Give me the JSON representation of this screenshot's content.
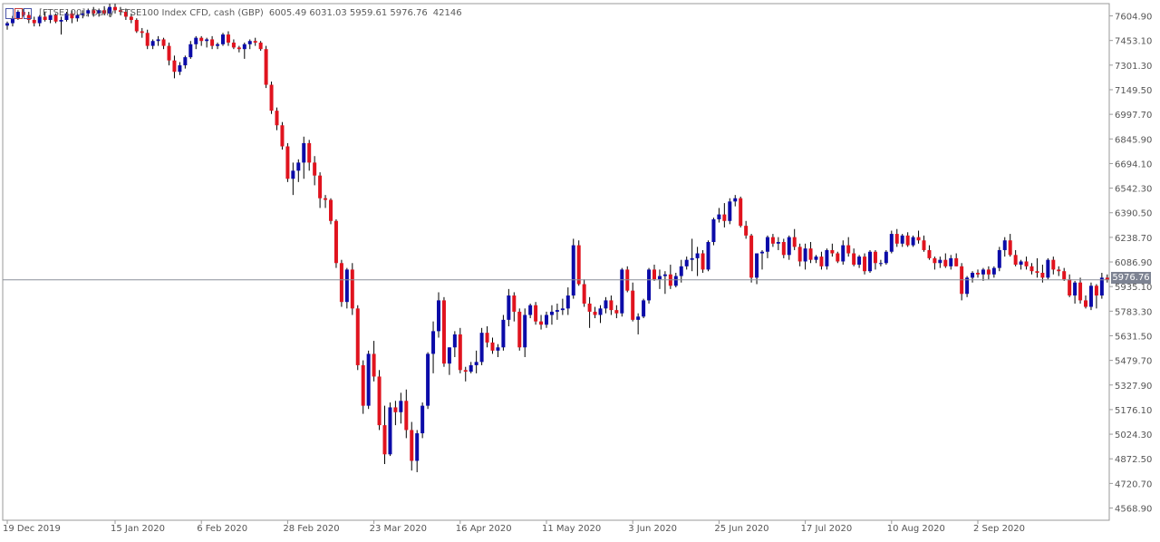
{
  "header": {
    "symbol": "[FTSE100], Daily",
    "description": "FTSE100 Index CFD, cash (GBP)",
    "ohlc": "6005.49 6031.03 5959.61 5976.76",
    "volume": "42146"
  },
  "colors": {
    "up": "#0b0ba8",
    "down": "#e0131e",
    "wick": "#000000",
    "current_line": "#8a8f9a",
    "tag_bg": "#7d8392"
  },
  "chart_data": {
    "type": "candlestick",
    "title": "",
    "xlabel": "",
    "ylabel": "",
    "current_price": "5976.76",
    "ylim": [
      4493.5,
      7680.6
    ],
    "y_ticks": [
      "7604.90",
      "7453.10",
      "7301.30",
      "7149.50",
      "6997.70",
      "6845.90",
      "6694.10",
      "6542.30",
      "6390.50",
      "6238.70",
      "6086.90",
      "5935.10",
      "5783.30",
      "5631.50",
      "5479.70",
      "5327.90",
      "5176.10",
      "5024.30",
      "4872.50",
      "4720.70",
      "4568.90"
    ],
    "x_ticks": [
      {
        "label": "19 Dec 2019",
        "index": 0
      },
      {
        "label": "15 Jan 2020",
        "index": 20
      },
      {
        "label": "6 Feb 2020",
        "index": 36
      },
      {
        "label": "28 Feb 2020",
        "index": 52
      },
      {
        "label": "23 Mar 2020",
        "index": 68
      },
      {
        "label": "16 Apr 2020",
        "index": 84
      },
      {
        "label": "11 May 2020",
        "index": 100
      },
      {
        "label": "3 Jun 2020",
        "index": 116
      },
      {
        "label": "25 Jun 2020",
        "index": 132
      },
      {
        "label": "17 Jul 2020",
        "index": 148
      },
      {
        "label": "10 Aug 2020",
        "index": 164
      },
      {
        "label": "2 Sep 2020",
        "index": 180
      }
    ],
    "candles": [
      [
        7545,
        7570,
        7520,
        7560
      ],
      [
        7560,
        7605,
        7540,
        7590
      ],
      [
        7590,
        7640,
        7580,
        7630
      ],
      [
        7630,
        7650,
        7600,
        7610
      ],
      [
        7610,
        7630,
        7560,
        7580
      ],
      [
        7580,
        7600,
        7540,
        7560
      ],
      [
        7560,
        7610,
        7540,
        7600
      ],
      [
        7600,
        7630,
        7570,
        7580
      ],
      [
        7580,
        7620,
        7560,
        7610
      ],
      [
        7610,
        7620,
        7560,
        7570
      ],
      [
        7570,
        7600,
        7490,
        7580
      ],
      [
        7580,
        7630,
        7570,
        7620
      ],
      [
        7620,
        7640,
        7560,
        7590
      ],
      [
        7590,
        7620,
        7570,
        7610
      ],
      [
        7610,
        7640,
        7590,
        7620
      ],
      [
        7620,
        7650,
        7600,
        7640
      ],
      [
        7640,
        7660,
        7600,
        7620
      ],
      [
        7620,
        7650,
        7600,
        7640
      ],
      [
        7640,
        7665,
        7610,
        7620
      ],
      [
        7620,
        7680,
        7600,
        7660
      ],
      [
        7660,
        7680,
        7620,
        7640
      ],
      [
        7640,
        7660,
        7610,
        7630
      ],
      [
        7630,
        7650,
        7580,
        7600
      ],
      [
        7600,
        7620,
        7560,
        7580
      ],
      [
        7580,
        7590,
        7500,
        7510
      ],
      [
        7510,
        7530,
        7470,
        7500
      ],
      [
        7500,
        7520,
        7400,
        7420
      ],
      [
        7420,
        7460,
        7400,
        7450
      ],
      [
        7450,
        7480,
        7420,
        7460
      ],
      [
        7460,
        7470,
        7400,
        7420
      ],
      [
        7420,
        7440,
        7300,
        7330
      ],
      [
        7330,
        7360,
        7220,
        7260
      ],
      [
        7260,
        7320,
        7240,
        7300
      ],
      [
        7300,
        7360,
        7280,
        7350
      ],
      [
        7350,
        7450,
        7340,
        7430
      ],
      [
        7430,
        7480,
        7400,
        7470
      ],
      [
        7470,
        7480,
        7420,
        7450
      ],
      [
        7450,
        7470,
        7410,
        7460
      ],
      [
        7460,
        7480,
        7400,
        7420
      ],
      [
        7420,
        7440,
        7400,
        7430
      ],
      [
        7430,
        7500,
        7420,
        7490
      ],
      [
        7490,
        7510,
        7420,
        7440
      ],
      [
        7440,
        7460,
        7400,
        7410
      ],
      [
        7410,
        7420,
        7380,
        7400
      ],
      [
        7400,
        7440,
        7340,
        7430
      ],
      [
        7430,
        7460,
        7400,
        7450
      ],
      [
        7450,
        7470,
        7420,
        7440
      ],
      [
        7440,
        7450,
        7390,
        7400
      ],
      [
        7400,
        7420,
        7160,
        7180
      ],
      [
        7180,
        7200,
        7000,
        7020
      ],
      [
        7020,
        7040,
        6900,
        6930
      ],
      [
        6930,
        6950,
        6780,
        6800
      ],
      [
        6800,
        6820,
        6580,
        6600
      ],
      [
        6600,
        6700,
        6500,
        6650
      ],
      [
        6650,
        6720,
        6580,
        6700
      ],
      [
        6700,
        6860,
        6600,
        6820
      ],
      [
        6820,
        6840,
        6650,
        6700
      ],
      [
        6700,
        6740,
        6560,
        6620
      ],
      [
        6620,
        6640,
        6420,
        6480
      ],
      [
        6480,
        6500,
        6420,
        6470
      ],
      [
        6470,
        6480,
        6320,
        6340
      ],
      [
        6340,
        6350,
        6050,
        6080
      ],
      [
        6080,
        6100,
        5810,
        5840
      ],
      [
        5840,
        6050,
        5800,
        6040
      ],
      [
        6040,
        6080,
        5760,
        5800
      ],
      [
        5800,
        5820,
        5420,
        5450
      ],
      [
        5450,
        5480,
        5150,
        5200
      ],
      [
        5200,
        5540,
        5180,
        5520
      ],
      [
        5520,
        5600,
        5350,
        5380
      ],
      [
        5380,
        5420,
        5050,
        5080
      ],
      [
        5080,
        5200,
        4840,
        4900
      ],
      [
        4900,
        5220,
        4890,
        5190
      ],
      [
        5190,
        5230,
        5080,
        5160
      ],
      [
        5160,
        5280,
        5090,
        5230
      ],
      [
        5230,
        5300,
        5000,
        5050
      ],
      [
        5050,
        5100,
        4800,
        4860
      ],
      [
        4860,
        5050,
        4790,
        5030
      ],
      [
        5030,
        5220,
        5000,
        5200
      ],
      [
        5200,
        5530,
        5180,
        5520
      ],
      [
        5520,
        5720,
        5400,
        5660
      ],
      [
        5660,
        5900,
        5620,
        5850
      ],
      [
        5850,
        5870,
        5440,
        5460
      ],
      [
        5460,
        5560,
        5390,
        5560
      ],
      [
        5560,
        5660,
        5500,
        5640
      ],
      [
        5640,
        5680,
        5400,
        5420
      ],
      [
        5420,
        5440,
        5350,
        5410
      ],
      [
        5410,
        5470,
        5400,
        5450
      ],
      [
        5450,
        5540,
        5400,
        5470
      ],
      [
        5470,
        5680,
        5450,
        5650
      ],
      [
        5650,
        5690,
        5560,
        5590
      ],
      [
        5590,
        5620,
        5520,
        5540
      ],
      [
        5540,
        5580,
        5500,
        5560
      ],
      [
        5560,
        5760,
        5540,
        5730
      ],
      [
        5730,
        5920,
        5690,
        5880
      ],
      [
        5880,
        5900,
        5720,
        5780
      ],
      [
        5780,
        5800,
        5540,
        5560
      ],
      [
        5560,
        5800,
        5500,
        5760
      ],
      [
        5760,
        5830,
        5740,
        5820
      ],
      [
        5820,
        5840,
        5700,
        5720
      ],
      [
        5720,
        5760,
        5670,
        5700
      ],
      [
        5700,
        5780,
        5680,
        5760
      ],
      [
        5760,
        5820,
        5700,
        5780
      ],
      [
        5780,
        5830,
        5730,
        5790
      ],
      [
        5790,
        5860,
        5760,
        5800
      ],
      [
        5800,
        5930,
        5760,
        5880
      ],
      [
        5880,
        6230,
        5860,
        6190
      ],
      [
        6190,
        6220,
        5940,
        5950
      ],
      [
        5950,
        5980,
        5810,
        5830
      ],
      [
        5830,
        5870,
        5680,
        5780
      ],
      [
        5780,
        5810,
        5740,
        5760
      ],
      [
        5760,
        5820,
        5710,
        5800
      ],
      [
        5800,
        5870,
        5770,
        5850
      ],
      [
        5850,
        5880,
        5760,
        5790
      ],
      [
        5790,
        5820,
        5740,
        5770
      ],
      [
        5770,
        6050,
        5750,
        6040
      ],
      [
        6040,
        6060,
        5900,
        5910
      ],
      [
        5910,
        5960,
        5720,
        5730
      ],
      [
        5730,
        5770,
        5640,
        5750
      ],
      [
        5750,
        5860,
        5740,
        5850
      ],
      [
        5850,
        6050,
        5830,
        6040
      ],
      [
        6040,
        6070,
        5970,
        5980
      ],
      [
        5980,
        6040,
        5920,
        6000
      ],
      [
        6000,
        6030,
        5890,
        6010
      ],
      [
        6010,
        6070,
        5920,
        5940
      ],
      [
        5940,
        6020,
        5930,
        6000
      ],
      [
        6000,
        6100,
        5960,
        6060
      ],
      [
        6060,
        6120,
        6040,
        6100
      ],
      [
        6100,
        6230,
        6030,
        6110
      ],
      [
        6110,
        6180,
        6000,
        6140
      ],
      [
        6140,
        6160,
        6020,
        6040
      ],
      [
        6040,
        6220,
        6030,
        6210
      ],
      [
        6210,
        6360,
        6190,
        6350
      ],
      [
        6350,
        6420,
        6330,
        6380
      ],
      [
        6380,
        6450,
        6300,
        6340
      ],
      [
        6340,
        6480,
        6320,
        6460
      ],
      [
        6460,
        6500,
        6430,
        6480
      ],
      [
        6480,
        6490,
        6300,
        6310
      ],
      [
        6310,
        6340,
        6230,
        6250
      ],
      [
        6250,
        6260,
        5960,
        5990
      ],
      [
        5990,
        6140,
        5950,
        6140
      ],
      [
        6140,
        6160,
        6040,
        6150
      ],
      [
        6150,
        6250,
        6110,
        6240
      ],
      [
        6240,
        6260,
        6180,
        6200
      ],
      [
        6200,
        6240,
        6160,
        6210
      ],
      [
        6210,
        6230,
        6110,
        6130
      ],
      [
        6130,
        6250,
        6100,
        6240
      ],
      [
        6240,
        6290,
        6160,
        6180
      ],
      [
        6180,
        6200,
        6060,
        6090
      ],
      [
        6090,
        6200,
        6040,
        6170
      ],
      [
        6170,
        6210,
        6080,
        6100
      ],
      [
        6100,
        6130,
        6080,
        6120
      ],
      [
        6120,
        6150,
        6040,
        6060
      ],
      [
        6060,
        6170,
        6040,
        6160
      ],
      [
        6160,
        6200,
        6120,
        6140
      ],
      [
        6140,
        6150,
        6080,
        6090
      ],
      [
        6090,
        6220,
        6070,
        6190
      ],
      [
        6190,
        6240,
        6120,
        6140
      ],
      [
        6140,
        6170,
        6060,
        6070
      ],
      [
        6070,
        6130,
        6050,
        6120
      ],
      [
        6120,
        6140,
        6010,
        6030
      ],
      [
        6030,
        6160,
        6020,
        6150
      ],
      [
        6150,
        6160,
        6040,
        6080
      ],
      [
        6080,
        6100,
        6060,
        6080
      ],
      [
        6080,
        6160,
        6070,
        6150
      ],
      [
        6150,
        6280,
        6140,
        6260
      ],
      [
        6260,
        6290,
        6180,
        6200
      ],
      [
        6200,
        6260,
        6180,
        6250
      ],
      [
        6250,
        6270,
        6180,
        6190
      ],
      [
        6190,
        6250,
        6180,
        6240
      ],
      [
        6240,
        6280,
        6200,
        6220
      ],
      [
        6220,
        6250,
        6150,
        6160
      ],
      [
        6160,
        6190,
        6100,
        6110
      ],
      [
        6110,
        6120,
        6040,
        6080
      ],
      [
        6080,
        6120,
        6050,
        6100
      ],
      [
        6100,
        6140,
        6050,
        6060
      ],
      [
        6060,
        6130,
        6040,
        6110
      ],
      [
        6110,
        6140,
        6060,
        6060
      ],
      [
        6060,
        6080,
        5850,
        5890
      ],
      [
        5890,
        6000,
        5870,
        5990
      ],
      [
        5990,
        6030,
        5960,
        6020
      ],
      [
        6020,
        6040,
        5990,
        6010
      ],
      [
        6010,
        6050,
        5970,
        6040
      ],
      [
        6040,
        6060,
        5980,
        6010
      ],
      [
        6010,
        6060,
        5990,
        6050
      ],
      [
        6050,
        6180,
        6030,
        6160
      ],
      [
        6160,
        6240,
        6120,
        6220
      ],
      [
        6220,
        6260,
        6120,
        6130
      ],
      [
        6130,
        6160,
        6060,
        6070
      ],
      [
        6070,
        6100,
        6040,
        6090
      ],
      [
        6090,
        6120,
        6040,
        6060
      ],
      [
        6060,
        6080,
        6010,
        6030
      ],
      [
        6030,
        6110,
        5990,
        6020
      ],
      [
        6020,
        6070,
        5960,
        5990
      ],
      [
        5990,
        6110,
        5980,
        6100
      ],
      [
        6100,
        6120,
        6010,
        6040
      ],
      [
        6040,
        6060,
        6000,
        6030
      ],
      [
        6030,
        6050,
        5970,
        5980
      ],
      [
        5980,
        6010,
        5870,
        5880
      ],
      [
        5880,
        5970,
        5830,
        5960
      ],
      [
        5960,
        5990,
        5830,
        5850
      ],
      [
        5850,
        5880,
        5800,
        5810
      ],
      [
        5810,
        5960,
        5790,
        5940
      ],
      [
        5940,
        5950,
        5800,
        5880
      ],
      [
        5880,
        6020,
        5860,
        5990
      ],
      [
        5990,
        6010,
        5960,
        5977
      ]
    ]
  }
}
